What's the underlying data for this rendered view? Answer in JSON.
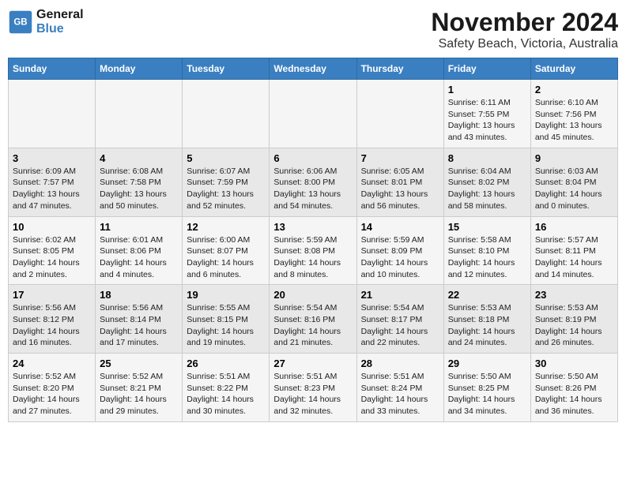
{
  "header": {
    "logo_line1": "General",
    "logo_line2": "Blue",
    "month": "November 2024",
    "location": "Safety Beach, Victoria, Australia"
  },
  "weekdays": [
    "Sunday",
    "Monday",
    "Tuesday",
    "Wednesday",
    "Thursday",
    "Friday",
    "Saturday"
  ],
  "weeks": [
    [
      {
        "day": "",
        "info": ""
      },
      {
        "day": "",
        "info": ""
      },
      {
        "day": "",
        "info": ""
      },
      {
        "day": "",
        "info": ""
      },
      {
        "day": "",
        "info": ""
      },
      {
        "day": "1",
        "info": "Sunrise: 6:11 AM\nSunset: 7:55 PM\nDaylight: 13 hours\nand 43 minutes."
      },
      {
        "day": "2",
        "info": "Sunrise: 6:10 AM\nSunset: 7:56 PM\nDaylight: 13 hours\nand 45 minutes."
      }
    ],
    [
      {
        "day": "3",
        "info": "Sunrise: 6:09 AM\nSunset: 7:57 PM\nDaylight: 13 hours\nand 47 minutes."
      },
      {
        "day": "4",
        "info": "Sunrise: 6:08 AM\nSunset: 7:58 PM\nDaylight: 13 hours\nand 50 minutes."
      },
      {
        "day": "5",
        "info": "Sunrise: 6:07 AM\nSunset: 7:59 PM\nDaylight: 13 hours\nand 52 minutes."
      },
      {
        "day": "6",
        "info": "Sunrise: 6:06 AM\nSunset: 8:00 PM\nDaylight: 13 hours\nand 54 minutes."
      },
      {
        "day": "7",
        "info": "Sunrise: 6:05 AM\nSunset: 8:01 PM\nDaylight: 13 hours\nand 56 minutes."
      },
      {
        "day": "8",
        "info": "Sunrise: 6:04 AM\nSunset: 8:02 PM\nDaylight: 13 hours\nand 58 minutes."
      },
      {
        "day": "9",
        "info": "Sunrise: 6:03 AM\nSunset: 8:04 PM\nDaylight: 14 hours\nand 0 minutes."
      }
    ],
    [
      {
        "day": "10",
        "info": "Sunrise: 6:02 AM\nSunset: 8:05 PM\nDaylight: 14 hours\nand 2 minutes."
      },
      {
        "day": "11",
        "info": "Sunrise: 6:01 AM\nSunset: 8:06 PM\nDaylight: 14 hours\nand 4 minutes."
      },
      {
        "day": "12",
        "info": "Sunrise: 6:00 AM\nSunset: 8:07 PM\nDaylight: 14 hours\nand 6 minutes."
      },
      {
        "day": "13",
        "info": "Sunrise: 5:59 AM\nSunset: 8:08 PM\nDaylight: 14 hours\nand 8 minutes."
      },
      {
        "day": "14",
        "info": "Sunrise: 5:59 AM\nSunset: 8:09 PM\nDaylight: 14 hours\nand 10 minutes."
      },
      {
        "day": "15",
        "info": "Sunrise: 5:58 AM\nSunset: 8:10 PM\nDaylight: 14 hours\nand 12 minutes."
      },
      {
        "day": "16",
        "info": "Sunrise: 5:57 AM\nSunset: 8:11 PM\nDaylight: 14 hours\nand 14 minutes."
      }
    ],
    [
      {
        "day": "17",
        "info": "Sunrise: 5:56 AM\nSunset: 8:12 PM\nDaylight: 14 hours\nand 16 minutes."
      },
      {
        "day": "18",
        "info": "Sunrise: 5:56 AM\nSunset: 8:14 PM\nDaylight: 14 hours\nand 17 minutes."
      },
      {
        "day": "19",
        "info": "Sunrise: 5:55 AM\nSunset: 8:15 PM\nDaylight: 14 hours\nand 19 minutes."
      },
      {
        "day": "20",
        "info": "Sunrise: 5:54 AM\nSunset: 8:16 PM\nDaylight: 14 hours\nand 21 minutes."
      },
      {
        "day": "21",
        "info": "Sunrise: 5:54 AM\nSunset: 8:17 PM\nDaylight: 14 hours\nand 22 minutes."
      },
      {
        "day": "22",
        "info": "Sunrise: 5:53 AM\nSunset: 8:18 PM\nDaylight: 14 hours\nand 24 minutes."
      },
      {
        "day": "23",
        "info": "Sunrise: 5:53 AM\nSunset: 8:19 PM\nDaylight: 14 hours\nand 26 minutes."
      }
    ],
    [
      {
        "day": "24",
        "info": "Sunrise: 5:52 AM\nSunset: 8:20 PM\nDaylight: 14 hours\nand 27 minutes."
      },
      {
        "day": "25",
        "info": "Sunrise: 5:52 AM\nSunset: 8:21 PM\nDaylight: 14 hours\nand 29 minutes."
      },
      {
        "day": "26",
        "info": "Sunrise: 5:51 AM\nSunset: 8:22 PM\nDaylight: 14 hours\nand 30 minutes."
      },
      {
        "day": "27",
        "info": "Sunrise: 5:51 AM\nSunset: 8:23 PM\nDaylight: 14 hours\nand 32 minutes."
      },
      {
        "day": "28",
        "info": "Sunrise: 5:51 AM\nSunset: 8:24 PM\nDaylight: 14 hours\nand 33 minutes."
      },
      {
        "day": "29",
        "info": "Sunrise: 5:50 AM\nSunset: 8:25 PM\nDaylight: 14 hours\nand 34 minutes."
      },
      {
        "day": "30",
        "info": "Sunrise: 5:50 AM\nSunset: 8:26 PM\nDaylight: 14 hours\nand 36 minutes."
      }
    ]
  ]
}
